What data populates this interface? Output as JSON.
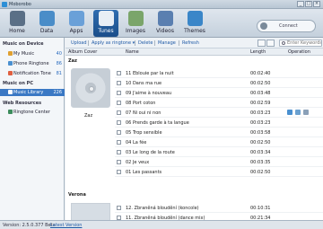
{
  "app": {
    "title": "Moborobo",
    "window_buttons": [
      "_",
      "□",
      "×"
    ]
  },
  "nav": [
    {
      "label": "Home",
      "icon": "phone-icon",
      "color": "#5a6f86"
    },
    {
      "label": "Data",
      "icon": "data-icon",
      "color": "#4a8dc8"
    },
    {
      "label": "Apps",
      "icon": "apps-icon",
      "color": "#6aa0d8"
    },
    {
      "label": "Tunes",
      "icon": "music-icon",
      "color": "#e8eef5"
    },
    {
      "label": "Images",
      "icon": "images-icon",
      "color": "#7aa56a"
    },
    {
      "label": "Videos",
      "icon": "videos-icon",
      "color": "#5a7fb0"
    },
    {
      "label": "Themes",
      "icon": "themes-icon",
      "color": "#3a86c8"
    }
  ],
  "connection": {
    "label": "Connect"
  },
  "sidebar": {
    "sections": [
      {
        "title": "Music on Device"
      },
      {
        "title": "Music on PC"
      },
      {
        "title": "Web Resources"
      }
    ],
    "items": [
      {
        "label": "My Music",
        "count": "40",
        "color": "#e0a030"
      },
      {
        "label": "Phone Ringtone",
        "count": "86",
        "color": "#4a90d0"
      },
      {
        "label": "Notification Tone",
        "count": "81",
        "color": "#e06040"
      },
      {
        "label": "Music Library",
        "count": "226",
        "color": "#ffffff"
      },
      {
        "label": "Ringtone Center",
        "count": "",
        "color": "#3c8c5c"
      }
    ]
  },
  "actions": [
    "Upload",
    "Apply as ringtone ▾",
    "Delete",
    "Manage",
    "Refresh"
  ],
  "search": {
    "placeholder": "Enter Keywords"
  },
  "table": {
    "headers": {
      "album_cover": "Album Cover",
      "name": "Name",
      "length": "Length",
      "operation": "Operation"
    },
    "groups": [
      {
        "name": "Zaz",
        "album": "Zaz",
        "tracks": [
          {
            "name": "11 Eblouie par la nuit",
            "length": "00:02:40"
          },
          {
            "name": "10 Dans ma rue",
            "length": "00:02:50"
          },
          {
            "name": "09 J'aime à nouveau",
            "length": "00:03:48"
          },
          {
            "name": "08 Port coton",
            "length": "00:02:59"
          },
          {
            "name": "07 Ni oui ni non",
            "length": "00:03:23"
          },
          {
            "name": "06 Prends garde à ta langue",
            "length": "00:03:23"
          },
          {
            "name": "05 Trop sensible",
            "length": "00:03:58"
          },
          {
            "name": "04 La fée",
            "length": "00:02:50"
          },
          {
            "name": "03 Le long de la route",
            "length": "00:03:34"
          },
          {
            "name": "02 Je veux",
            "length": "00:03:35"
          },
          {
            "name": "01 Les passants",
            "length": "00:02:50"
          }
        ]
      },
      {
        "name": "Verona",
        "album": "",
        "tracks": [
          {
            "name": "12. Zbraněná bloudění (koncole)",
            "length": "00:10:31"
          },
          {
            "name": "11. Zbraněná bloudění (dance mix)",
            "length": "00:21:34"
          }
        ]
      }
    ]
  },
  "status": {
    "version": "Version: 2.5.0.377 Beta",
    "link": "Latest Version"
  }
}
